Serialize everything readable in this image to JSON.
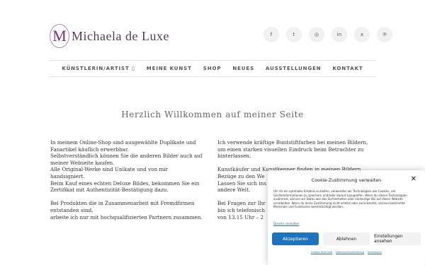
{
  "header": {
    "logo_monogram": "M",
    "logo_text": "Michaela de Luxe",
    "social": [
      {
        "icon": "facebook-icon",
        "glyph": "f"
      },
      {
        "icon": "twitter-icon",
        "glyph": "t"
      },
      {
        "icon": "instagram-icon",
        "glyph": "◎"
      },
      {
        "icon": "linkedin-icon",
        "glyph": "in"
      },
      {
        "icon": "xing-icon",
        "glyph": "x"
      },
      {
        "icon": "pinterest-icon",
        "glyph": "℗"
      }
    ]
  },
  "nav": {
    "items": [
      "KÜNSTLERIN/ARTIST ▯",
      "MEINE KUNST",
      "SHOP",
      "NEUES",
      "AUSSTELLUNGEN",
      "KONTAKT"
    ]
  },
  "headline": "Herzlich Willkommen auf meiner Seite",
  "col1": {
    "p1": "In meinem Online-Shop sind ausgewählte Duplikate und Fanartikel käuflich erwerbbar.",
    "p2": "Selbstverständlich können Sie die anderen Bilder auch auf meiner Webseite kaufen.",
    "p3": "Alle Original-Werke sind Unikate und von mir handsigniert.",
    "p4": "Beim Kauf eines echten Deluxe Bildes, bekommen Sie ein Zertifikat mit Authentizität-Bestätigung dazu.",
    "p5": "Bei Produkten die in Zusammenarbeit mit Fremdfirmen entstanden sind,",
    "p6": "arbeite ich nur mit hochqualifizierten Partnern zusammen."
  },
  "col2": {
    "p1": "Ich verwende kräftige Buntstiftfarben bei meinen Bildern, um einen starken visuellen Eindruck beim Betrachter zu hinterlassen.",
    "p2": "Kunstkäufer und Kunstkenner finden in meinen Bildern Bezüge zu den We",
    "p3": "Lassen Sie sich ins",
    "p4": "andere Welt.",
    "p5": "Bei Fragen zur Ihr",
    "p6": "bin ich telefonisch",
    "p7": "von 13.15 Uhr – 2"
  },
  "bottom_text": "",
  "cookie": {
    "title": "Cookie-Zustimmung verwalten",
    "close": "✕",
    "body": "Um dir ein optimales Erlebnis zu bieten, verwenden wir Technologien wie Cookies, um Geräteinformationen zu speichern und/oder darauf zuzugreifen. Wenn du diesen Technologien zustimmst, können wir Daten wie das Surfverhalten oder eindeutige IDs auf dieser Website verarbeiten. Wenn du deine Zustimmung nicht erteilst oder zurückziehst, können bestimmte Merkmale und Funktionen beeinträchtigt werden.",
    "services_link": "Dienste verwalten",
    "accept": "Akzeptieren",
    "deny": "Ablehnen",
    "settings": "Einstellungen ansehen",
    "footer_links": [
      "Cookie-Richtlinie",
      "Datenschutzerklärung",
      "Impressum"
    ]
  }
}
